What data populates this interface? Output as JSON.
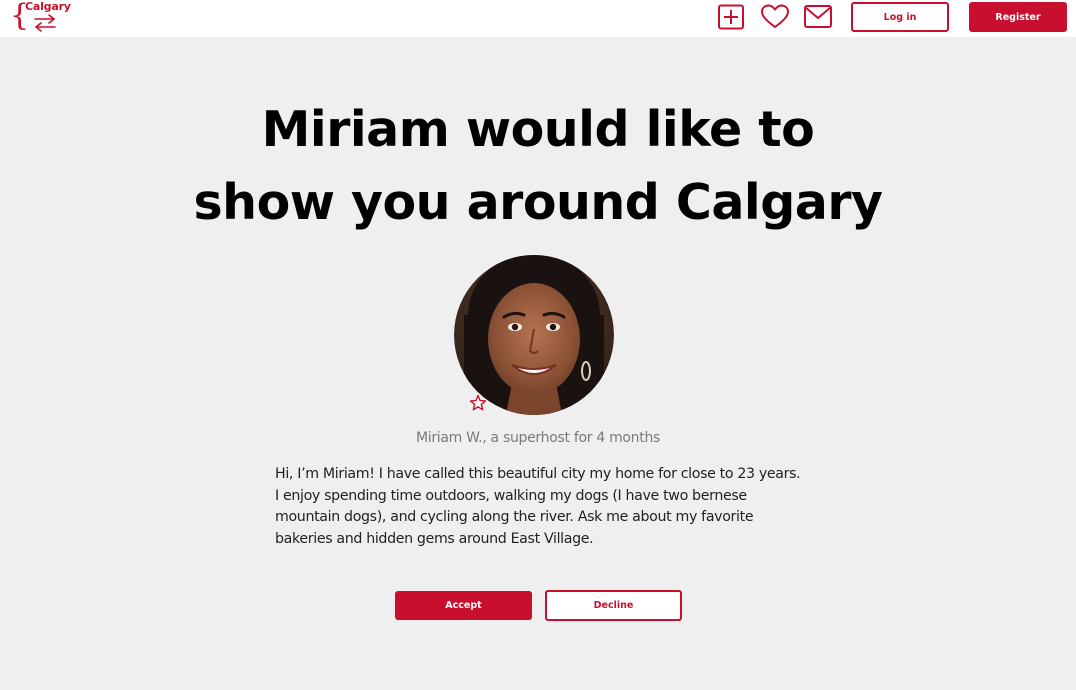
{
  "brand": {
    "name": "Calgary",
    "color": "#c8102e",
    "logo_icon": "swap-arrows-icon"
  },
  "header": {
    "icons": [
      "add-icon",
      "heart-icon",
      "mail-icon"
    ],
    "login_label": "Log in",
    "register_label": "Register"
  },
  "main": {
    "headline_line1": "Miriam would like to",
    "headline_line2": "show you around Calgary",
    "avatar_alt": "Miriam W.",
    "badge_icon": "star-icon",
    "host_caption": "Miriam W., a superhost for 4 months",
    "bio_lines": [
      "Hi, I’m Miriam! I have called this beautiful city my home for close to 23 years.",
      "I enjoy spending time outdoors, walking my dogs (I have two bernese",
      "mountain dogs), and cycling along the river. Ask me about my favorite",
      "bakeries and hidden gems around East Village."
    ],
    "accept_label": "Accept",
    "decline_label": "Decline"
  }
}
